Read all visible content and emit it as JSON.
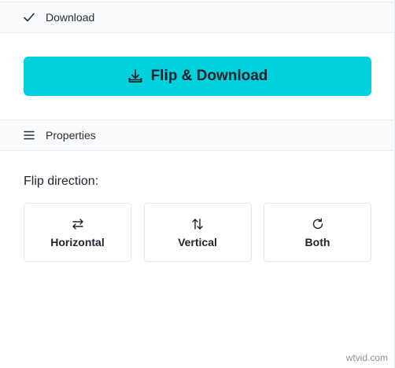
{
  "download_section": {
    "title": "Download",
    "icon": "check-icon"
  },
  "primary_button": {
    "label": "Flip & Download",
    "icon": "download-icon",
    "color": "#00d1dc"
  },
  "properties_section": {
    "title": "Properties",
    "icon": "menu-icon"
  },
  "flip": {
    "label": "Flip direction:",
    "options": [
      {
        "label": "Horizontal",
        "icon": "swap-horizontal-icon"
      },
      {
        "label": "Vertical",
        "icon": "swap-vertical-icon"
      },
      {
        "label": "Both",
        "icon": "rotate-icon"
      }
    ]
  },
  "watermark": "wtvid.com"
}
